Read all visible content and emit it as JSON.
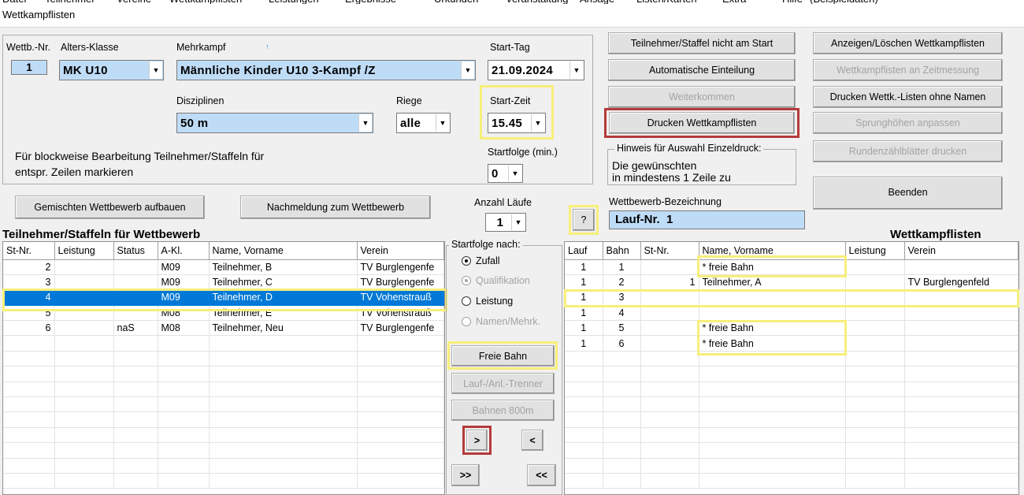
{
  "menu": [
    "Datei",
    "Teilnehmer",
    "Vereine",
    "Wettkampflisten",
    "Leistungen",
    "Ergebnisse",
    "Urkunden",
    "Veranstaltung",
    "Ansage",
    "Listen/Karten",
    "Extra",
    "Hilfe",
    "(Beispieldaten)"
  ],
  "window": {
    "title": "Wettkampflisten"
  },
  "form": {
    "wettb_nr_label": "Wettb.-Nr.",
    "wettb_nr_value": "1",
    "alters_klasse_label": "Alters-Klasse",
    "alters_klasse_value": "MK U10",
    "mehrkampf_label": "Mehrkampf",
    "mehrkampf_marker": "↑",
    "mehrkampf_value": "Männliche Kinder U10  3-Kampf /Z",
    "start_tag_label": "Start-Tag",
    "start_tag_value": "21.09.2024",
    "disziplinen_label": "Disziplinen",
    "disziplinen_value": "50 m",
    "riege_label": "Riege",
    "riege_value": "alle",
    "start_zeit_label": "Start-Zeit",
    "start_zeit_value": "15.45",
    "block_hint_line1": "Für blockweise Bearbeitung Teilnehmer/Staffeln für",
    "block_hint_line2": "entspr. Zeilen markieren",
    "startfolge_min_label": "Startfolge (min.)",
    "startfolge_min_value": "0",
    "anzahl_laeufe_label": "Anzahl Läufe",
    "anzahl_laeufe_value": "1",
    "help_button": "?",
    "wettbewerb_bez_label": "Wettbewerb-Bezeichnung",
    "wettbewerb_bez_value": "Lauf-Nr.  1"
  },
  "buttons": {
    "gemischt": "Gemischten Wettbewerb aufbauen",
    "nachmeldung": "Nachmeldung zum Wettbewerb",
    "nicht_am_start": "Teilnehmer/Staffel nicht am Start",
    "auto_einteilung": "Automatische Einteilung",
    "weiterkommen": "Weiterkommen",
    "drucken": "Drucken Wettkampflisten",
    "anzeigen_loeschen": "Anzeigen/Löschen Wettkampflisten",
    "zeitmessung": "Wettkampflisten an Zeitmessung",
    "drucken_ohne_namen": "Drucken Wettk.-Listen ohne Namen",
    "sprunghoehen": "Sprunghöhen anpassen",
    "rundenzaehl": "Rundenzählblätter drucken",
    "beenden": "Beenden",
    "freie_bahn": "Freie Bahn",
    "trenner": "Lauf-/Anl.-Trenner",
    "bahnen800": "Bahnen 800m",
    "move_right": ">",
    "move_left": "<",
    "move_all_right": ">>",
    "move_all_left": "<<"
  },
  "hinweis": {
    "legend": "Hinweis für Auswahl Einzeldruck:",
    "line1": "Die gewünschten",
    "line2": "in mindestens 1 Zeile zu"
  },
  "startfolge_nach": {
    "legend": "Startfolge nach:",
    "options": [
      {
        "label": "Zufall",
        "checked": true,
        "enabled": true
      },
      {
        "label": "Qualifikation",
        "checked": true,
        "enabled": false
      },
      {
        "label": "Leistung",
        "checked": false,
        "enabled": true
      },
      {
        "label": "Namen/Mehrk.",
        "checked": false,
        "enabled": false
      }
    ]
  },
  "participants": {
    "title": "Teilnehmer/Staffeln für Wettbewerb",
    "columns": [
      "St-Nr.",
      "Leistung",
      "Status",
      "A-Kl.",
      "Name, Vorname",
      "Verein"
    ],
    "rows": [
      [
        "2",
        "",
        "",
        "M09",
        "Teilnehmer, B",
        "TV Burglengenfe"
      ],
      [
        "3",
        "",
        "",
        "M09",
        "Teilnehmer, C",
        "TV Burglengenfe"
      ],
      [
        "4",
        "",
        "",
        "M09",
        "Teilnehmer, D",
        "TV Vohenstrauß"
      ],
      [
        "5",
        "",
        "",
        "M08",
        "Teilnehmer, E",
        "TV Vohenstrauß"
      ],
      [
        "6",
        "",
        "naS",
        "M08",
        "Teilnehmer, Neu",
        "TV Burglengenfe"
      ]
    ],
    "selected_index": 2
  },
  "lists": {
    "title": "Wettkampflisten",
    "columns": [
      "Lauf",
      "Bahn",
      "St-Nr.",
      "Name, Vorname",
      "Leistung",
      "Verein"
    ],
    "rows": [
      [
        "1",
        "1",
        "",
        "* freie Bahn",
        "",
        ""
      ],
      [
        "1",
        "2",
        "1",
        "Teilnehmer, A",
        "",
        "TV Burglengenfeld"
      ],
      [
        "1",
        "3",
        "",
        "",
        "",
        ""
      ],
      [
        "1",
        "4",
        "",
        "",
        "",
        ""
      ],
      [
        "1",
        "5",
        "",
        "* freie Bahn",
        "",
        ""
      ],
      [
        "1",
        "6",
        "",
        "* freie Bahn",
        "",
        ""
      ]
    ]
  },
  "colors": {
    "selection": "#0078d7",
    "combo_bg": "#bfdcf7",
    "highlight_yellow": "#f7ef7a",
    "highlight_red": "#b53a3a"
  },
  "icons": {
    "dropdown": "chevron-down-icon"
  }
}
